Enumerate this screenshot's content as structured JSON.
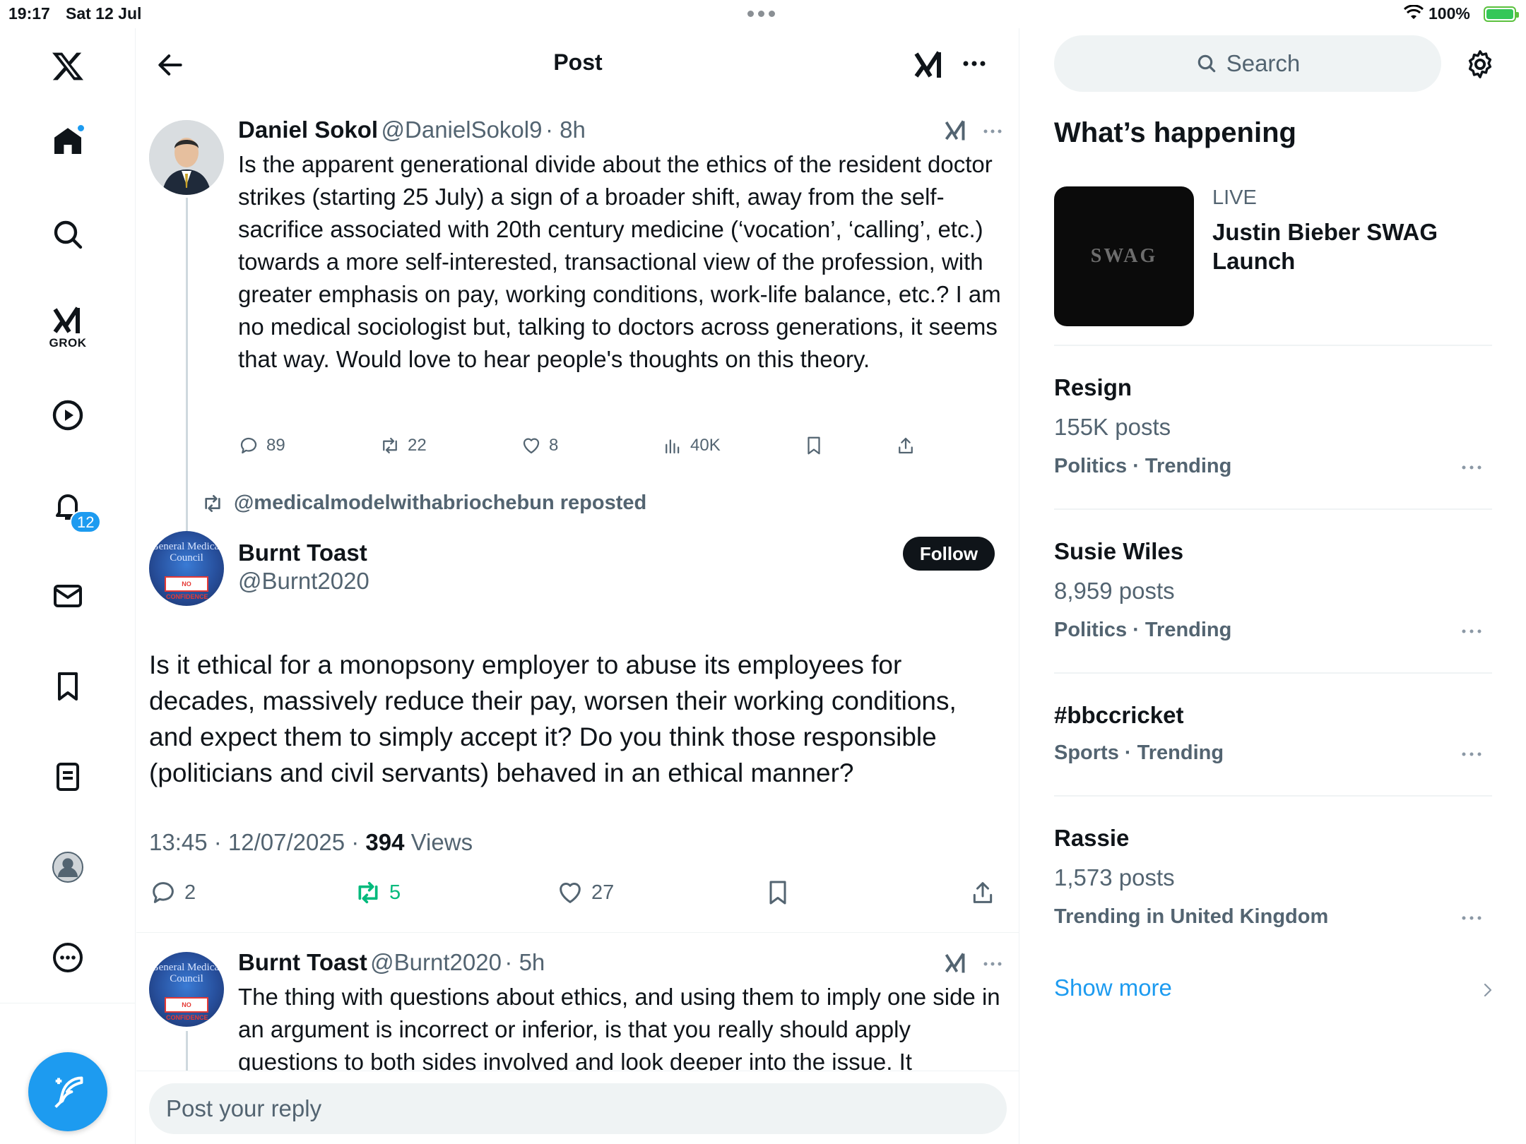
{
  "status_bar": {
    "time": "19:17",
    "date": "Sat 12 Jul",
    "battery": "100%"
  },
  "nav": {
    "notifications_count": "12",
    "grok_label": "GROK"
  },
  "header": {
    "title": "Post"
  },
  "parent_tweet": {
    "name": "Daniel Sokol",
    "handle": "@DanielSokol9",
    "time": "· 8h",
    "text": "Is the apparent generational divide about the ethics of the resident doctor strikes (starting 25 July) a sign of a broader shift, away from the self-sacrifice associated with 20th century medicine (‘vocation’, ‘calling’, etc.) towards a more self-interested, transactional view of the profession, with greater emphasis on pay, working conditions, work-life balance, etc.? I am no medical sociologist but, talking to doctors across generations, it seems that way. Would love to hear people's thoughts on this theory.",
    "replies": "89",
    "reposts": "22",
    "likes": "8",
    "views": "40K"
  },
  "repost_notice": "@medicalmodelwithabriochebun reposted",
  "main_tweet": {
    "name": "Burnt Toast",
    "handle": "@Burnt2020",
    "follow_label": "Follow",
    "text": "Is it ethical for a monopsony employer to abuse its employees for decades, massively reduce their pay, worsen their working conditions, and expect them to simply accept it? Do you think those responsible (politicians and civil servants) behaved in an ethical manner?",
    "timestamp": "13:45 · 12/07/2025 · ",
    "views_count": "394",
    "views_label": " Views",
    "replies": "2",
    "reposts": "5",
    "likes": "27"
  },
  "reply_tweet": {
    "name": "Burnt Toast",
    "handle": "@Burnt2020",
    "time": "· 5h",
    "text": "The thing with questions about ethics, and using them to imply one side in an argument is incorrect or inferior, is that you really should apply questions to both sides involved and look deeper into the issue. It"
  },
  "reply_bar": {
    "placeholder": "Post your reply"
  },
  "avatar_text": {
    "toast_line": "General Medical Council",
    "toast_stamp": "NO CONFIDENCE"
  },
  "sidebar": {
    "search_placeholder": "Search",
    "section_title": "What’s happening",
    "live": {
      "label": "LIVE",
      "title": "Justin Bieber SWAG Launch",
      "image_text": "SWAG"
    },
    "trends": [
      {
        "name": "Resign",
        "posts": "155K posts",
        "category": "Politics · Trending"
      },
      {
        "name": "Susie Wiles",
        "posts": "8,959 posts",
        "category": "Politics · Trending"
      },
      {
        "name": "#bbccricket",
        "posts": "",
        "category": "Sports · Trending"
      },
      {
        "name": "Rassie",
        "posts": "1,573 posts",
        "category": "Trending in United Kingdom"
      }
    ],
    "show_more": "Show more"
  },
  "colors": {
    "accent": "#1d9bf0",
    "repost_active": "#00ba7c",
    "muted": "#536471"
  }
}
